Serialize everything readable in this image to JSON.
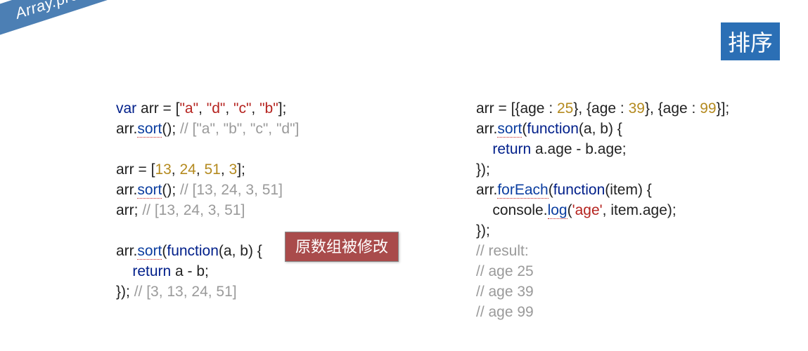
{
  "ribbon": "Array.prototype.sort",
  "title": "排序",
  "note": "原数组被修改",
  "left": {
    "line1_a": "var",
    "line1_b": " arr = [",
    "line1_c": "\"a\"",
    "line1_d": ", ",
    "line1_e": "\"d\"",
    "line1_f": ", ",
    "line1_g": "\"c\"",
    "line1_h": ", ",
    "line1_i": "\"b\"",
    "line1_j": "];",
    "line2_a": "arr.",
    "line2_b": "sort",
    "line2_c": "(); ",
    "line2_d": "// [\"a\", \"b\", \"c\", \"d\"]",
    "line4_a": "arr = [",
    "line4_b": "13",
    "line4_c": ", ",
    "line4_d": "24",
    "line4_e": ", ",
    "line4_f": "51",
    "line4_g": ", ",
    "line4_h": "3",
    "line4_i": "];",
    "line5_a": "arr.",
    "line5_b": "sort",
    "line5_c": "(); ",
    "line5_d": "// [13, 24, 3, 51]",
    "line6_a": "arr; ",
    "line6_b": "// [13, 24, 3, 51]",
    "line8_a": "arr.",
    "line8_b": "sort",
    "line8_c": "(",
    "line8_d": "function",
    "line8_e": "(a, b) {",
    "line9_a": "    ",
    "line9_b": "return",
    "line9_c": " a - b;",
    "line10_a": "}); ",
    "line10_b": "// [3, 13, 24, 51]"
  },
  "right": {
    "line1_a": "arr = [{age : ",
    "line1_b": "25",
    "line1_c": "}, {age : ",
    "line1_d": "39",
    "line1_e": "}, {age : ",
    "line1_f": "99",
    "line1_g": "}];",
    "line2_a": "arr.",
    "line2_b": "sort",
    "line2_c": "(",
    "line2_d": "function",
    "line2_e": "(a, b) {",
    "line3_a": "    ",
    "line3_b": "return",
    "line3_c": " a.age - b.age;",
    "line4_a": "});",
    "line5_a": "arr.",
    "line5_b": "forEach",
    "line5_c": "(",
    "line5_d": "function",
    "line5_e": "(item) {",
    "line6_a": "    console.",
    "line6_b": "log",
    "line6_c": "(",
    "line6_d": "'age'",
    "line6_e": ", item.age);",
    "line7_a": "});",
    "line8_a": "// result:",
    "line9_a": "// age 25",
    "line10_a": "// age 39",
    "line11_a": "// age 99"
  }
}
